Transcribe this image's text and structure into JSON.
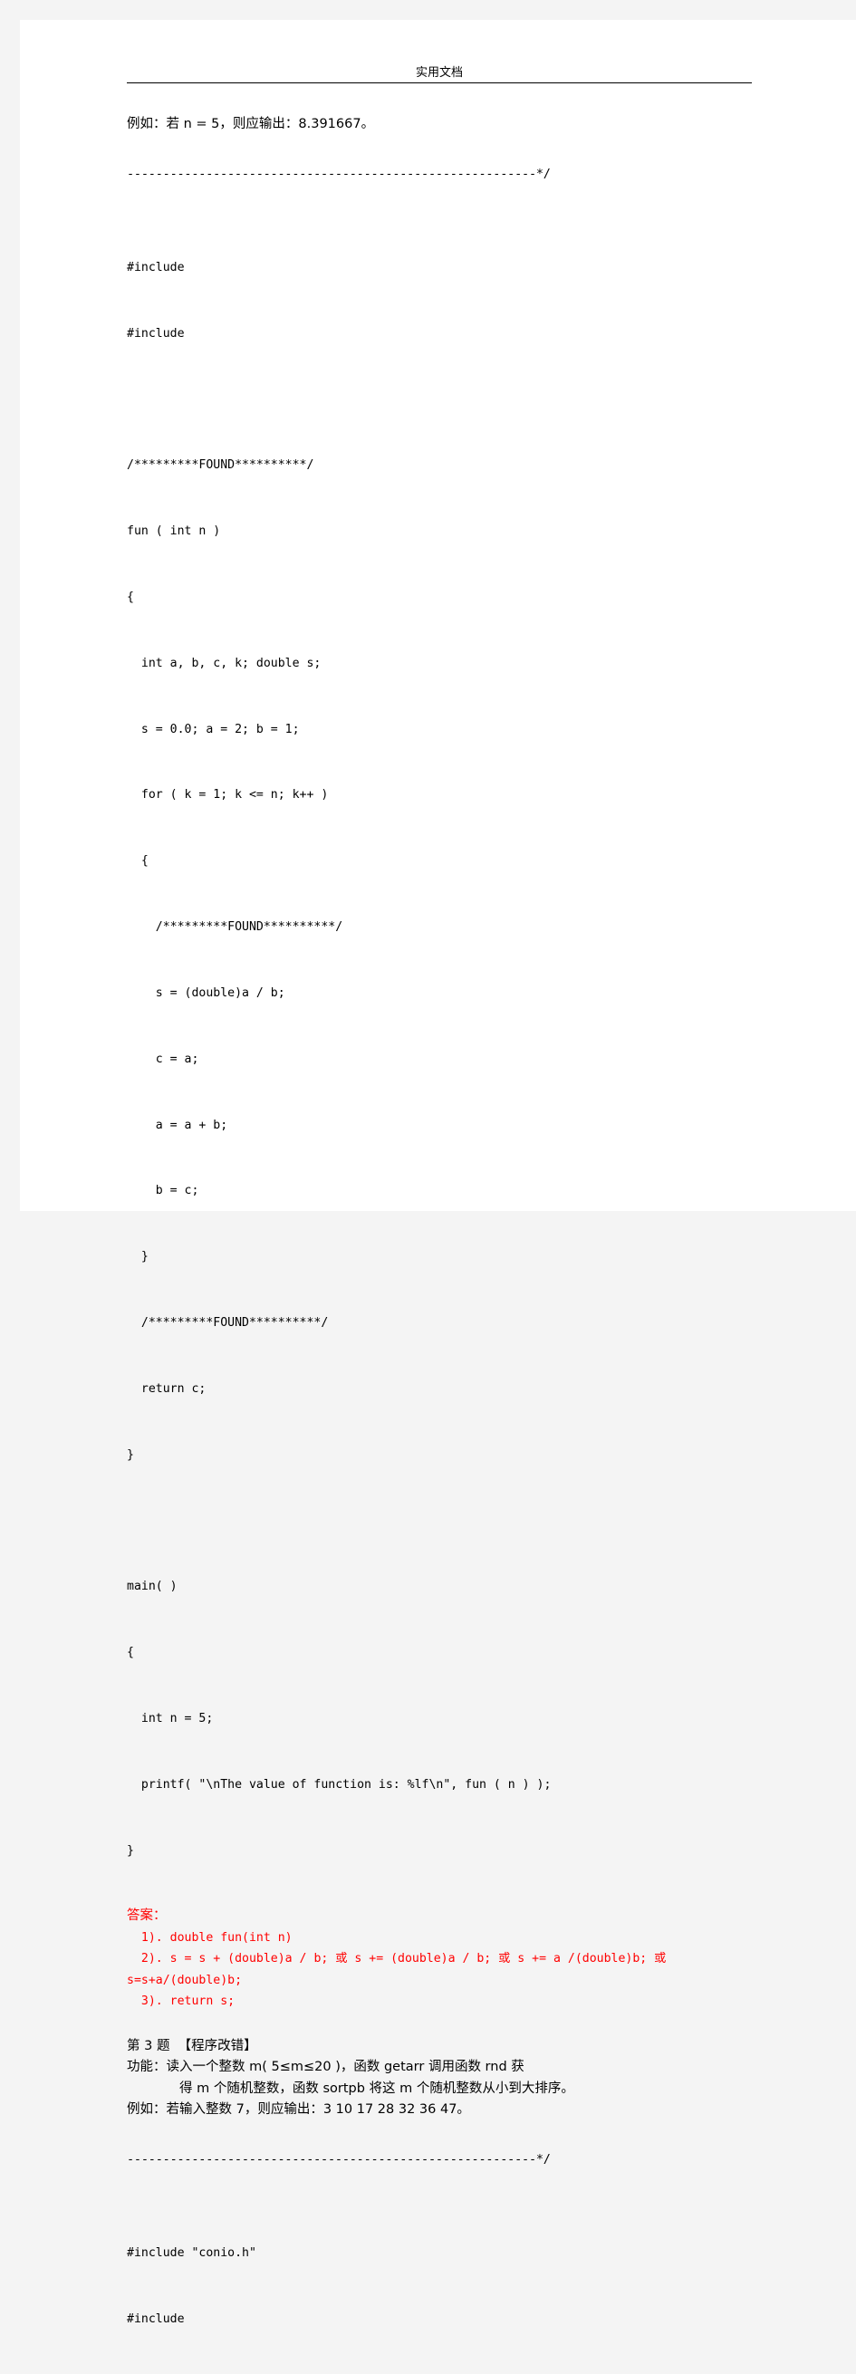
{
  "page": {
    "header_title": "实用文档",
    "background_color": "#f4f4f4",
    "sheet_color": "#ffffff",
    "answer_color": "#ff0000"
  },
  "problem2": {
    "example_line": "例如：若 n = 5，则应输出：8.391667。",
    "separator": "---------------------------------------------------------*/",
    "code": [
      "#include",
      "#include",
      "",
      "/*********FOUND**********/",
      "fun ( int n )",
      "{",
      "  int a, b, c, k; double s;",
      "  s = 0.0; a = 2; b = 1;",
      "  for ( k = 1; k <= n; k++ )",
      "  {",
      "    /*********FOUND**********/",
      "    s = (double)a / b;",
      "    c = a;",
      "    a = a + b;",
      "    b = c;",
      "  }",
      "  /*********FOUND**********/",
      "  return c;",
      "}",
      "",
      "main( )",
      "{",
      "  int n = 5;",
      "  printf( \"\\nThe value of function is: %lf\\n\", fun ( n ) );",
      "}"
    ],
    "answer": {
      "label": "答案：",
      "items": [
        "  1). double fun(int n)",
        "  2). s = s + (double)a / b; 或 s += (double)a / b; 或 s += a /(double)b; 或 s=s+a/(double)b;",
        "  3). return s;"
      ]
    }
  },
  "problem3": {
    "title": "第 3 题  【程序改错】",
    "function_line1": "功能：读入一个整数 m( 5≤m≤20 )，函数 getarr 调用函数 rnd 获",
    "function_line2": "得 m 个随机整数，函数 sortpb 将这 m 个随机整数从小到大排序。",
    "example_line": "例如：若输入整数 7，则应输出：3 10 17 28 32 36 47。",
    "separator": "---------------------------------------------------------*/",
    "code": [
      "#include \"conio.h\"",
      "#include"
    ]
  }
}
